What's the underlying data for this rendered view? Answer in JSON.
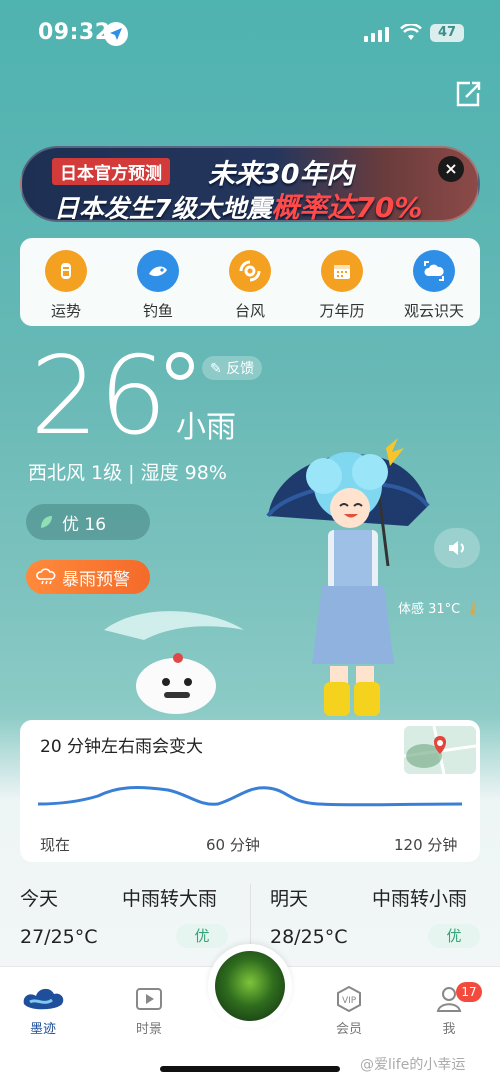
{
  "status": {
    "time": "09:32",
    "battery": "47"
  },
  "banner": {
    "tag": "日本官方预测",
    "line1": "未来30年内",
    "line2_prefix": "日本发生7级大地震",
    "line2_highlight": "概率达70%",
    "close_symbol": "×"
  },
  "tools": [
    {
      "label": "运势",
      "icon": "fortune-icon",
      "color": "#f4a020"
    },
    {
      "label": "钓鱼",
      "icon": "fish-icon",
      "color": "#2f8ee6"
    },
    {
      "label": "台风",
      "icon": "typhoon-icon",
      "color": "#f4a020"
    },
    {
      "label": "万年历",
      "icon": "calendar-icon",
      "color": "#f4a020"
    },
    {
      "label": "观云识天",
      "icon": "cloud-icon",
      "color": "#2f8ee6"
    }
  ],
  "current": {
    "temp": "26",
    "feedback": "反馈",
    "condition": "小雨",
    "wind_humidity": "西北风 1级 | 湿度 98%",
    "aqi": "优 16",
    "alert": "暴雨预警",
    "feels_like": "体感 31°C"
  },
  "rain": {
    "title": "20 分钟左右雨会变大",
    "ticks": [
      "现在",
      "60 分钟",
      "120 分钟"
    ]
  },
  "daily": [
    {
      "day": "今天",
      "desc": "中雨转大雨",
      "temp": "27/25°C",
      "aqi": "优"
    },
    {
      "day": "明天",
      "desc": "中雨转小雨",
      "temp": "28/25°C",
      "aqi": "优"
    }
  ],
  "tabs": [
    {
      "label": "墨迹",
      "active": true
    },
    {
      "label": "时景",
      "active": false
    },
    {
      "label": "会员",
      "active": false
    },
    {
      "label": "我",
      "active": false
    }
  ],
  "notification_count": "17",
  "watermark": "@爱life的小幸运",
  "colors": {
    "accent": "#2f8ee6",
    "alert": "#f46a2a",
    "good": "#38a37a"
  }
}
